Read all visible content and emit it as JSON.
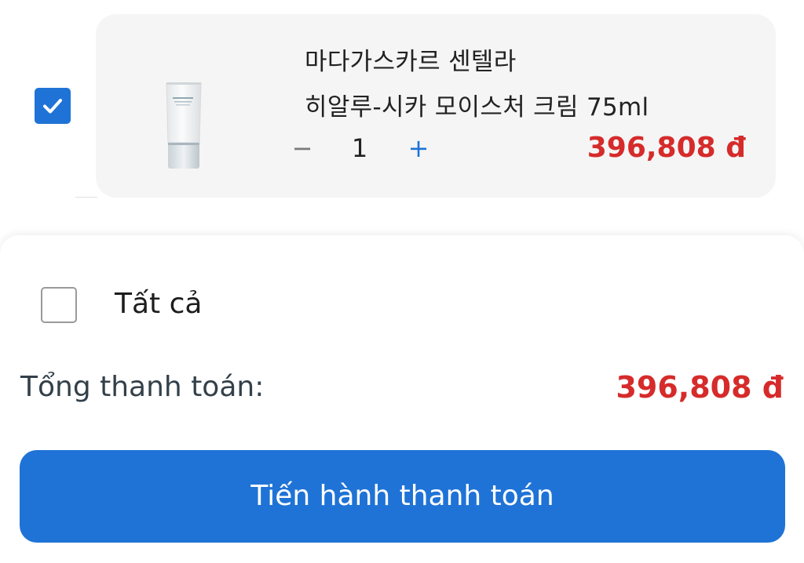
{
  "cart_item": {
    "selected": true,
    "name_line1": "마다가스카르 센텔라",
    "name_line2": "히알루-시카 모이스처 크림 75ml",
    "quantity": "1",
    "minus_label": "−",
    "plus_label": "+",
    "price": "396,808 đ"
  },
  "footer": {
    "select_all_checked": false,
    "select_all_label": "Tất cả",
    "total_label": "Tổng thanh toán:",
    "total_value": "396,808 đ",
    "checkout_label": "Tiến hành thanh toán"
  },
  "colors": {
    "accent": "#1f73d6",
    "price": "#d62b2b",
    "card_background": "#f5f5f5"
  },
  "icons": {
    "item_checkbox": "checkmark-icon",
    "product": "cream-tube-image"
  }
}
